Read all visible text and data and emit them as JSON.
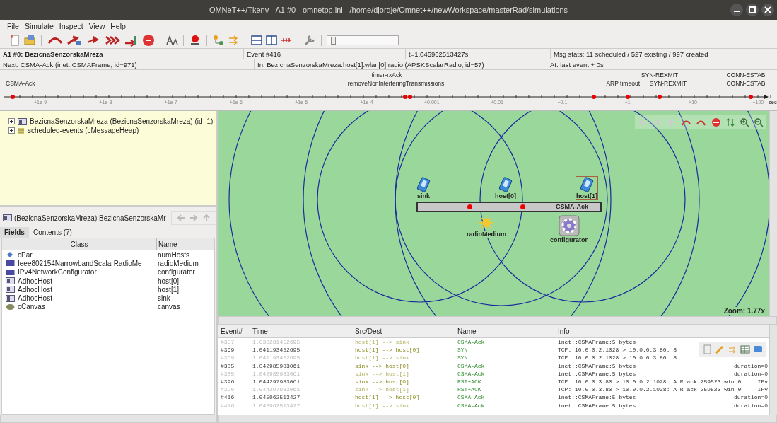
{
  "window": {
    "title": "OMNeT++/Tkenv - A1 #0 - omnetpp.ini - /home/djordje/Omnet++/newWorkspace/masterRad/simulations"
  },
  "menu": [
    "File",
    "Simulate",
    "Inspect",
    "View",
    "Help"
  ],
  "status": {
    "network": "A1 #0: BezicnaSenzorskaMreza",
    "event": "Event #416",
    "time": "t=1.045962513427s",
    "msg_stats": "Msg stats: 11 scheduled / 527 existing / 997 created",
    "next": "Next: CSMA-Ack (inet::CSMAFrame, id=971)",
    "module": "In: BezicnaSenzorskaMreza.host[1].wlan[0].radio (APSKScalarRadio, id=57)",
    "at": "At: last event + 0s"
  },
  "speed_slider": {
    "level": 0.05
  },
  "timeline": {
    "events": [
      "timer-rxAck",
      "SYN-REXMIT",
      "CONN-ESTAB",
      "CSMA-Ack",
      "removeNonInterferingTransmissions",
      "ARP timeout",
      "SYN-REXMIT",
      "CONN-ESTAB"
    ],
    "ticks": [
      "+1e-9",
      "+1e-8",
      "+1e-7",
      "+1e-6",
      "+1e-5",
      "+1e-4",
      "+0.001",
      "+0.01",
      "+0.1",
      "+1",
      "+10",
      "+100"
    ],
    "unit": "sec"
  },
  "object_tree": [
    {
      "label": "BezicnaSenzorskaMreza (BezicnaSenzorskaMreza) (id=1)",
      "kind": "module",
      "expanded": false
    },
    {
      "label": "scheduled-events (cMessageHeap)",
      "kind": "queue",
      "expanded": false
    }
  ],
  "inspector": {
    "title": "(BezicnaSenzorskaMreza) BezicnaSenzorskaMr",
    "tabs": [
      {
        "label": "Fields",
        "selected": true
      },
      {
        "label": "Contents (7)",
        "selected": false
      }
    ],
    "columns": [
      "Class",
      "Name"
    ],
    "rows": [
      {
        "class": "cPar",
        "name": "numHosts",
        "kind": "param"
      },
      {
        "class": "Ieee802154NarrowbandScalarRadioMe",
        "name": "radioMedium",
        "kind": "object"
      },
      {
        "class": "IPv4NetworkConfigurator",
        "name": "configurator",
        "kind": "object"
      },
      {
        "class": "AdhocHost",
        "name": "host[0]",
        "kind": "module"
      },
      {
        "class": "AdhocHost",
        "name": "host[1]",
        "kind": "module"
      },
      {
        "class": "AdhocHost",
        "name": "sink",
        "kind": "module"
      },
      {
        "class": "cCanvas",
        "name": "canvas",
        "kind": "canvas"
      }
    ]
  },
  "network": {
    "nodes": [
      {
        "name": "sink",
        "kind": "host",
        "highlighted": false
      },
      {
        "name": "radioMedium",
        "kind": "medium",
        "highlighted": false
      },
      {
        "name": "host[0]",
        "kind": "host",
        "highlighted": false
      },
      {
        "name": "configurator",
        "kind": "configurator",
        "highlighted": false
      },
      {
        "name": "host[1]",
        "kind": "host",
        "highlighted": true
      }
    ],
    "message_label": "CSMA-Ack",
    "zoom": "Zoom: 1.77x"
  },
  "event_log": {
    "columns": [
      "Event#",
      "Time",
      "Src/Dest",
      "Name",
      "Info"
    ],
    "rows": [
      {
        "event": "#357",
        "time": "1.038281452695",
        "src_dest": "host[1] --> sink",
        "name": "CSMA-Ack",
        "info": "inet::CSMAFrame:5 bytes",
        "extra": "",
        "faded": true
      },
      {
        "event": "#369",
        "time": "1.041193452695",
        "src_dest": "host[1] --> host[0]",
        "name": "SYN",
        "info": "TCP: 10.0.0.2.1028 > 10.0.0.3.80: S",
        "extra": "",
        "faded": false
      },
      {
        "event": "#369",
        "time": "1.041193452695",
        "src_dest": "host[1] --> sink",
        "name": "SYN",
        "info": "TCP: 10.0.0.2.1028 > 10.0.0.3.80: S",
        "extra": "",
        "faded": true
      },
      {
        "event": "#385",
        "time": "1.042985983061",
        "src_dest": "sink --> host[0]",
        "name": "CSMA-Ack",
        "info": "inet::CSMAFrame:5 bytes",
        "extra": "duration=0",
        "faded": false
      },
      {
        "event": "#385",
        "time": "1.042985983061",
        "src_dest": "sink --> host[1]",
        "name": "CSMA-Ack",
        "info": "inet::CSMAFrame:5 bytes",
        "extra": "duration=0",
        "faded": true
      },
      {
        "event": "#396",
        "time": "1.044297983061",
        "src_dest": "sink --> host[0]",
        "name": "RST+ACK",
        "info": "TCP: 10.0.0.3.80 > 10.0.0.2.1028: A R ack 259523 win 0",
        "extra": "IPv",
        "faded": false
      },
      {
        "event": "#396",
        "time": "1.044297983061",
        "src_dest": "sink --> host[1]",
        "name": "RST+ACK",
        "info": "TCP: 10.0.0.3.80 > 10.0.0.2.1028: A R ack 259523 win 0",
        "extra": "IPv",
        "faded": true
      },
      {
        "event": "#416",
        "time": "1.045962513427",
        "src_dest": "host[1] --> host[0]",
        "name": "CSMA-Ack",
        "info": "inet::CSMAFrame:5 bytes",
        "extra": "duration=0",
        "faded": false
      },
      {
        "event": "#416",
        "time": "1.045962513427",
        "src_dest": "host[1] --> sink",
        "name": "CSMA-Ack",
        "info": "inet::CSMAFrame:5 bytes",
        "extra": "duration=0",
        "faded": true
      }
    ]
  }
}
